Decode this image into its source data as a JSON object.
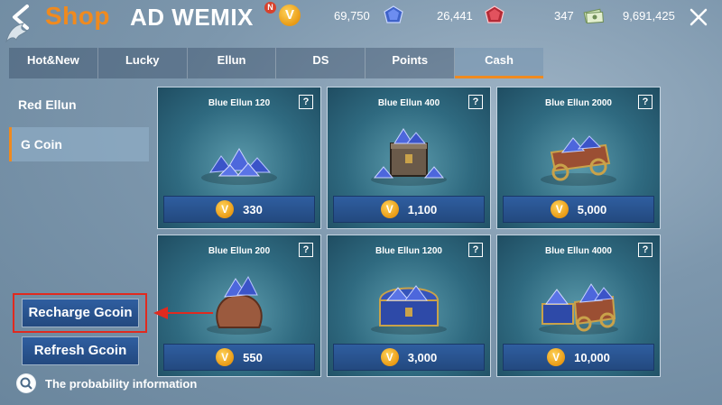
{
  "header": {
    "title": "Shop",
    "brand": "AD  WEMIX",
    "badge": "N",
    "coin_symbol": "V",
    "blue_amount": "69,750",
    "red_amount": "26,441",
    "ticket_amount": "347",
    "cash_amount": "9,691,425"
  },
  "tabs": [
    "Hot&New",
    "Lucky",
    "Ellun",
    "DS",
    "Points",
    "Cash"
  ],
  "active_tab": "Cash",
  "side_menu": [
    "Red Ellun",
    "G Coin"
  ],
  "active_side": "G Coin",
  "products": [
    {
      "name": "Blue Ellun 120",
      "price": "330",
      "art": "gems-pile"
    },
    {
      "name": "Blue Ellun 400",
      "price": "1,100",
      "art": "gems-chest"
    },
    {
      "name": "Blue Ellun 2000",
      "price": "5,000",
      "art": "gems-cart"
    },
    {
      "name": "Blue Ellun 200",
      "price": "550",
      "art": "gems-bag"
    },
    {
      "name": "Blue Ellun 1200",
      "price": "3,000",
      "art": "gems-treasure-chest"
    },
    {
      "name": "Blue Ellun 4000",
      "price": "10,000",
      "art": "gems-wagon"
    }
  ],
  "buttons": {
    "recharge": "Recharge Gcoin",
    "refresh": "Refresh Gcoin"
  },
  "probability_text": "The probability information",
  "help_symbol": "?",
  "colors": {
    "accent": "#f08a1e",
    "button": "#2f5ea0",
    "highlight": "#e02a1f"
  }
}
